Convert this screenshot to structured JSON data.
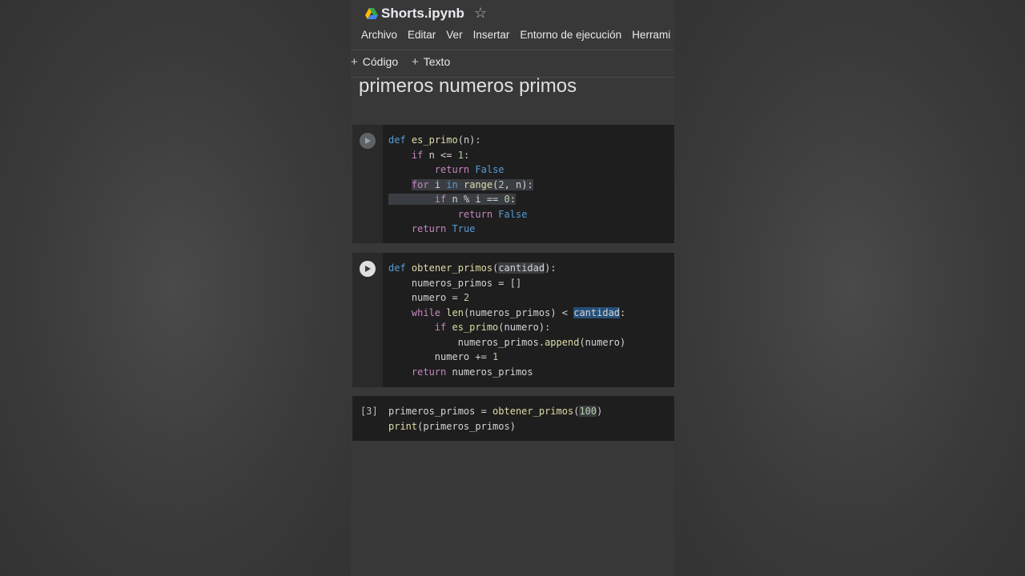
{
  "header": {
    "title": "Shorts.ipynb",
    "star_icon": "☆",
    "menu": [
      "Archivo",
      "Editar",
      "Ver",
      "Insertar",
      "Entorno de ejecución",
      "Herrami"
    ]
  },
  "toolbar": {
    "add_code_label": "Código",
    "add_text_label": "Texto"
  },
  "markdown": {
    "heading": "primeros numeros primos"
  },
  "cells": [
    {
      "lines": [
        "def es_primo(n):",
        "    if n <= 1:",
        "        return False",
        "    for i in range(2, n):",
        "        if n % i == 0:",
        "            return False",
        "    return True"
      ]
    },
    {
      "lines": [
        "def obtener_primos(cantidad):",
        "    numeros_primos = []",
        "    numero = 2",
        "    while len(numeros_primos) < cantidad:",
        "        if es_primo(numero):",
        "            numeros_primos.append(numero)",
        "        numero += 1",
        "    return numeros_primos"
      ]
    },
    {
      "exec_count": "[3]",
      "lines": [
        "primeros_primos = obtener_primos(100)",
        "print(primeros_primos)"
      ]
    }
  ],
  "colors": {
    "keyword": "#c586c0",
    "keyword_const": "#569cd6",
    "function": "#dcdcaa",
    "number": "#b5cea8"
  }
}
